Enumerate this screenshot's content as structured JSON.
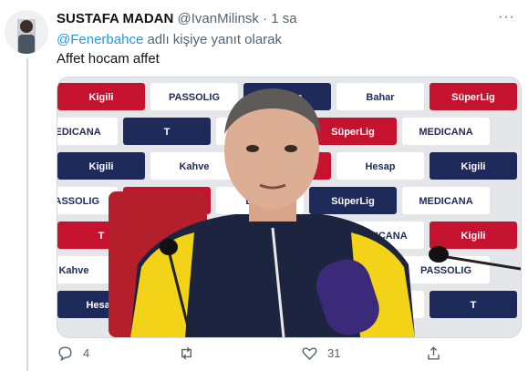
{
  "tweet": {
    "author_name": "SUSTAFA MADAN",
    "handle": "@IvanMilinsk",
    "separator": "·",
    "time": "1 sa",
    "reply_prefix": "@Fenerbahce",
    "reply_suffix": " adlı kişiye yanıt olarak",
    "text": "Affet hocam affet",
    "more_label": "···"
  },
  "media": {
    "board_sponsors": [
      "Kigili",
      "PASSOLIG",
      "Hesap",
      "Bahar",
      "SüperLig",
      "MEDICANA",
      "T",
      "Kigili",
      "SüperLig",
      "MEDICANA",
      "Kigili",
      "Kahve",
      "T",
      "Hesap"
    ]
  },
  "actions": {
    "reply_count": "4",
    "retweet_count": "",
    "like_count": "31"
  },
  "colors": {
    "accent": "#1d9bf0",
    "secondary_text": "#536471",
    "board_red": "#c4122f",
    "board_navy": "#1e2a5a",
    "jacket_yellow": "#f2d318"
  }
}
